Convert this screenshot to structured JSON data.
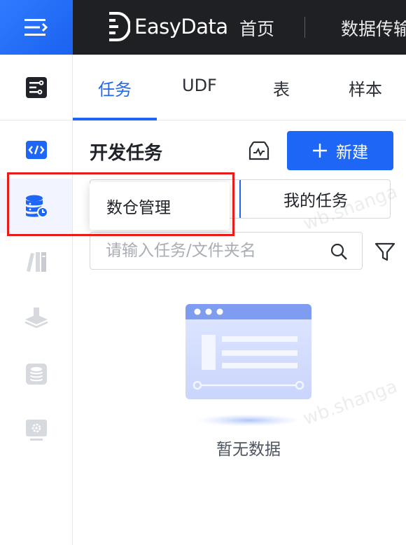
{
  "topbar": {
    "brand": "EasyData",
    "nav_home": "首页",
    "nav_transfer": "数据传输"
  },
  "tabs": [
    "任务",
    "UDF",
    "表",
    "样本"
  ],
  "active_tab": "任务",
  "panel": {
    "title": "开发任务",
    "new_button": "新建",
    "segment_left": "数仓管理",
    "segment_right": "我的任务",
    "search_placeholder": "请输入任务/文件夹名",
    "empty_text": "暂无数据"
  },
  "popover": {
    "label": "数仓管理"
  },
  "watermark": "wb.shanga",
  "icons": {
    "menu": "menu-expand-icon",
    "brand_logo": "easydata-logo-icon",
    "rail_top": "task-list-icon",
    "rail_items": [
      "code-icon",
      "data-warehouse-icon",
      "library-icon",
      "layers-icon",
      "database-icon",
      "settings-monitor-icon"
    ],
    "import": "import-icon",
    "search": "search-icon",
    "filter": "filter-icon",
    "add": "plus-icon"
  },
  "colors": {
    "primary": "#1e66f5",
    "topbar_bg": "#1f2023",
    "highlight": "#e81b1b"
  }
}
